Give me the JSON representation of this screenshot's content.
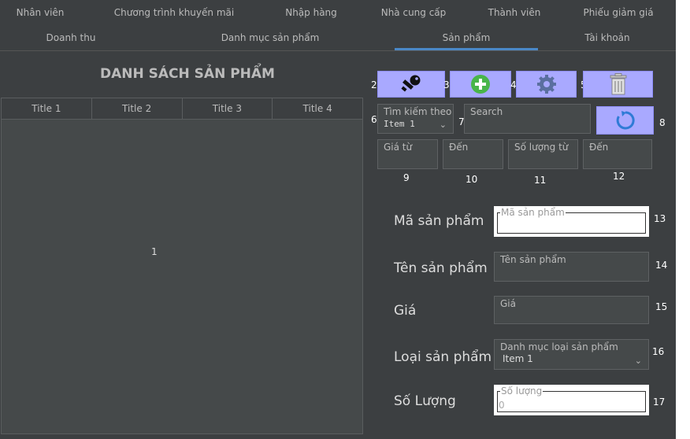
{
  "tabs_row1": [
    "Nhân viên",
    "Chương trình khuyến mãi",
    "Nhập hàng",
    "Nhà cung cấp",
    "Thành viên",
    "Phiếu giảm giá"
  ],
  "tabs_row2": [
    "Doanh thu",
    "Danh mục sản phẩm",
    "Sản phẩm",
    "Tài khoản"
  ],
  "selected_tab": "Sản phẩm",
  "list_title": "DANH SÁCH SẢN PHẨM",
  "table": {
    "columns": [
      "Title 1",
      "Title 2",
      "Title 3",
      "Title 4"
    ],
    "area_label": "1"
  },
  "toolbar": {
    "buttons": [
      {
        "number": "2",
        "icon": "key-icon"
      },
      {
        "number": "3",
        "icon": "add-icon"
      },
      {
        "number": "4",
        "icon": "gear-icon"
      },
      {
        "number": "5",
        "icon": "trash-icon"
      }
    ]
  },
  "search": {
    "search_by_label": "Tìm kiếm theo",
    "search_by_value": "Item 1",
    "search_by_number": "6",
    "search_label": "Search",
    "search_number": "7",
    "refresh_number": "8",
    "refresh_icon": "refresh-icon"
  },
  "filters": {
    "price_from": {
      "label": "Giá từ",
      "number": "9"
    },
    "price_to": {
      "label": "Đến",
      "number": "10"
    },
    "qty_from": {
      "label": "Số lượng từ",
      "number": "11"
    },
    "qty_to": {
      "label": "Đến",
      "number": "12"
    }
  },
  "form": {
    "code": {
      "label": "Mã sản phẩm",
      "field_label": "Mã sản phẩm",
      "number": "13"
    },
    "name": {
      "label": "Tên sản phẩm",
      "field_label": "Tên sản phẩm",
      "number": "14"
    },
    "price": {
      "label": "Giá",
      "field_label": "Giá",
      "number": "15"
    },
    "category": {
      "label": "Loại sản phẩm",
      "field_label": "Danh mục loại sản phẩm",
      "value": "Item 1",
      "number": "16"
    },
    "quantity": {
      "label": "Số Lượng",
      "field_label": "Số lượng",
      "value": "0",
      "number": "17"
    }
  },
  "colors": {
    "background": "#3c3f41",
    "button": "#a9a9ff",
    "accent": "#4a88c7",
    "add_green": "#49b54a"
  }
}
